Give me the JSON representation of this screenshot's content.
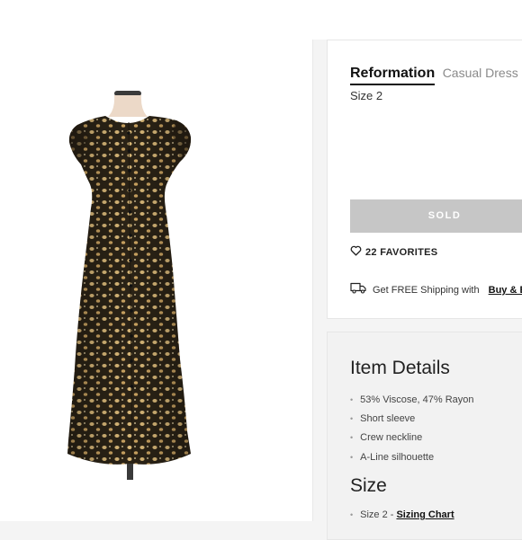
{
  "product": {
    "brand": "Reformation",
    "category": "Casual Dress",
    "size_label": "Size 2",
    "image_alt": "Reformation floral print button-front midi dress"
  },
  "purchase": {
    "sold_label": "SOLD",
    "favorites_label": "22 FAVORITES",
    "shipping_text": "Get FREE Shipping with",
    "shipping_link": "Buy & Bu"
  },
  "details": {
    "title": "Item Details",
    "items": [
      "53% Viscose, 47% Rayon",
      "Short sleeve",
      "Crew neckline",
      "A-Line silhouette"
    ],
    "bullet": "•"
  },
  "size_section": {
    "title": "Size",
    "value": "Size 2 -",
    "sizing_chart_label": "Sizing Chart"
  },
  "colors": {
    "dress_base": "#2b2316",
    "dress_dots": "#d9b878",
    "sold_button_bg": "#c6c6c6",
    "page_bg": "#f4f4f4"
  },
  "icons": {
    "favorite": "heart-icon",
    "shipping": "truck-icon"
  }
}
